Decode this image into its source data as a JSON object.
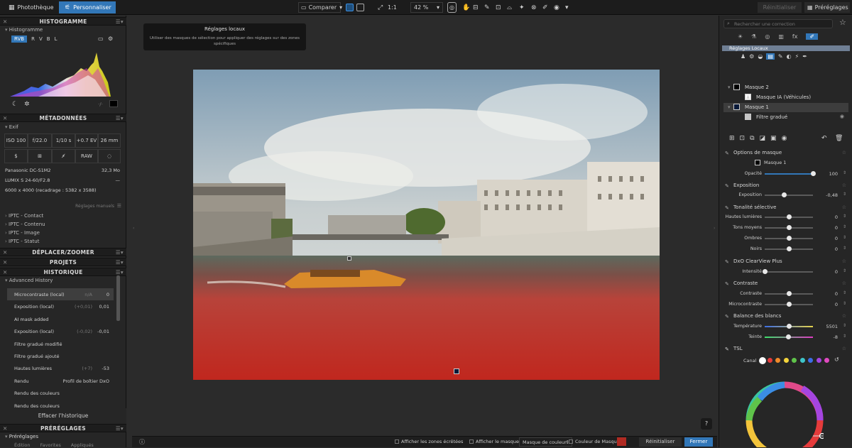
{
  "topbar": {
    "tabs": [
      {
        "label": "Photothèque",
        "icon": "grid-icon"
      },
      {
        "label": "Personnaliser",
        "icon": "sliders-icon"
      }
    ],
    "compare_label": "Comparer",
    "ratio_label": "1:1",
    "zoom": "42 %",
    "reset_label": "Réinitialiser",
    "presets_label": "Préréglages"
  },
  "left": {
    "histogram": {
      "title": "HISTOGRAMME",
      "sub": "Histogramme",
      "channels": [
        "RVB",
        "R",
        "V",
        "B",
        "L"
      ]
    },
    "metadata": {
      "title": "MÉTADONNÉES",
      "sub": "Exif",
      "row1": [
        "ISO 100",
        "f/22.0",
        "1/10 s",
        "+0.7 EV",
        "26 mm"
      ],
      "row2": [
        "$",
        "",
        "",
        "RAW",
        ""
      ],
      "camera": "Panasonic DC-S1M2",
      "size": "32,3 Mo",
      "lens": "LUMIX S 24-60/F2.8",
      "lens_val": "—",
      "dims": "6000 x 4000 (recadrage : 5382 x 3588)",
      "wb": "Réglages manuels",
      "iptc": [
        "IPTC - Contact",
        "IPTC - Contenu",
        "IPTC - Image",
        "IPTC - Statut"
      ]
    },
    "move_zoom": "DÉPLACER/ZOOMER",
    "projects": "PROJETS",
    "history": {
      "title": "HISTORIQUE",
      "sub": "Advanced History",
      "items": [
        {
          "label": "Microcontraste (local)",
          "mid": "n/A",
          "val": "0"
        },
        {
          "label": "Exposition (local)",
          "mid": "(+0,01)",
          "val": "0,01"
        },
        {
          "label": "AI mask added",
          "mid": "",
          "val": ""
        },
        {
          "label": "Exposition (local)",
          "mid": "(-0,02)",
          "val": "-0,01"
        },
        {
          "label": "Filtre gradué modifié",
          "mid": "",
          "val": ""
        },
        {
          "label": "Filtre gradué ajouté",
          "mid": "",
          "val": ""
        },
        {
          "label": "Hautes lumières",
          "mid": "(+7)",
          "val": "-53"
        },
        {
          "label": "Rendu",
          "mid": "",
          "val": "Profil de boîtier DxO"
        },
        {
          "label": "Rendu des couleurs",
          "mid": "",
          "val": ""
        },
        {
          "label": "Rendu des couleurs",
          "mid": "",
          "val": ""
        }
      ],
      "clear_label": "Effacer l'historique"
    },
    "presets": {
      "title": "PRÉRÉGLAGES",
      "sub": "Préréglages",
      "tabs": [
        "Édition",
        "Favorites",
        "Appliqués"
      ]
    }
  },
  "center": {
    "tooltip_title": "Réglages locaux",
    "tooltip_text": "Utiliser des masques de sélection pour appliquer des réglages sur des zones spécifiques",
    "help": "?"
  },
  "bottombar": {
    "show_clipped": "Afficher les zones écrêtées",
    "show_mask": "Afficher le masque",
    "mask_type": "Masque de couleur",
    "mask_color_label": "Couleur de Masque",
    "mask_color": "#b02a22",
    "reset": "Réinitialiser",
    "close": "Fermer"
  },
  "right": {
    "search_placeholder": "Rechercher une correction",
    "local_title": "Réglages Locaux",
    "masks": [
      {
        "label": "Masque 2"
      },
      {
        "label": "Masque IA (Véhicules)"
      },
      {
        "label": "Masque 1"
      },
      {
        "label": "Filtre gradué"
      }
    ],
    "mask_options": {
      "title": "Options de masque",
      "mask_name": "Masque 1",
      "opacity_label": "Opacité",
      "opacity": "100",
      "opacity_frac": 1.0
    },
    "exposure": {
      "title": "Exposition",
      "label": "Exposition",
      "value": "-0,48",
      "frac": 0.4
    },
    "tonality": {
      "title": "Tonalité sélective",
      "items": [
        {
          "label": "Hautes lumières",
          "value": "0",
          "frac": 0.5
        },
        {
          "label": "Tons moyens",
          "value": "0",
          "frac": 0.5
        },
        {
          "label": "Ombres",
          "value": "0",
          "frac": 0.5
        },
        {
          "label": "Noirs",
          "value": "0",
          "frac": 0.5
        }
      ]
    },
    "clearview": {
      "title": "DxO ClearView Plus",
      "label": "Intensité",
      "value": "0",
      "frac": 0.0
    },
    "contrast": {
      "title": "Contraste",
      "items": [
        {
          "label": "Contraste",
          "value": "0",
          "frac": 0.5
        },
        {
          "label": "Microcontraste",
          "value": "0",
          "frac": 0.5
        }
      ]
    },
    "wb": {
      "title": "Balance des blancs",
      "items": [
        {
          "label": "Température",
          "value": "5501",
          "frac": 0.5
        },
        {
          "label": "Teinte",
          "value": "-8",
          "frac": 0.49
        }
      ]
    },
    "hsl": {
      "title": "TSL",
      "channel_label": "Canal",
      "channels": [
        "#ffffff",
        "#e53b3b",
        "#f08a2a",
        "#f3d43b",
        "#5fc34a",
        "#3ec4c9",
        "#3b6de5",
        "#a545e0",
        "#e04ac0"
      ]
    }
  }
}
